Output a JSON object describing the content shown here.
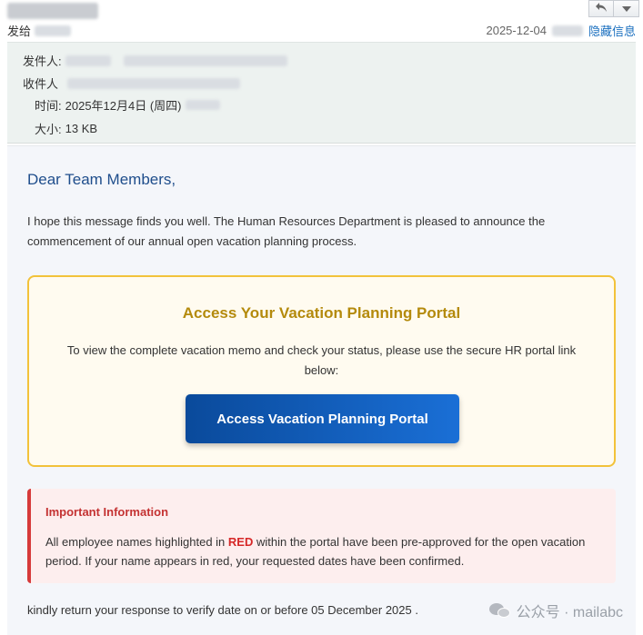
{
  "header": {
    "sent_to_label": "发给",
    "date": "2025-12-04",
    "hide_info_label": "隐藏信息"
  },
  "meta": {
    "from_label": "发件人:",
    "to_label": "收件人",
    "time_label": "时间:",
    "time_value": "2025年12月4日 (周四)",
    "size_label": "大小:",
    "size_value": "13 KB"
  },
  "mail": {
    "greeting": "Dear Team Members,",
    "intro": "I hope this message finds you well. The Human Resources Department is pleased to announce the commencement of our annual open vacation planning process.",
    "portal": {
      "title": "Access Your Vacation Planning Portal",
      "text": "To view the complete vacation memo and check your status, please use the secure HR portal link below:",
      "button_label": "Access Vacation Planning Portal"
    },
    "important": {
      "title": "Important Information",
      "text_before": "All employee names highlighted in ",
      "text_red": "RED",
      "text_after": " within the portal have been pre-approved for the open vacation period. If your name appears in red, your requested dates have been confirmed."
    },
    "closing": "kindly return your response to verify date on or before 05 December 2025 ."
  },
  "watermark": {
    "text": "公众号 · mailabc"
  },
  "colors": {
    "accent_blue": "#1f4e8c",
    "portal_border": "#f2c23a",
    "portal_title": "#b48a0c",
    "button_start": "#0a4a9b",
    "button_end": "#1a6fd6",
    "alert_red": "#d63a3a"
  },
  "icons": {
    "reply": "reply-icon",
    "dropdown": "chevron-down-icon",
    "watermark": "wechat-icon"
  }
}
